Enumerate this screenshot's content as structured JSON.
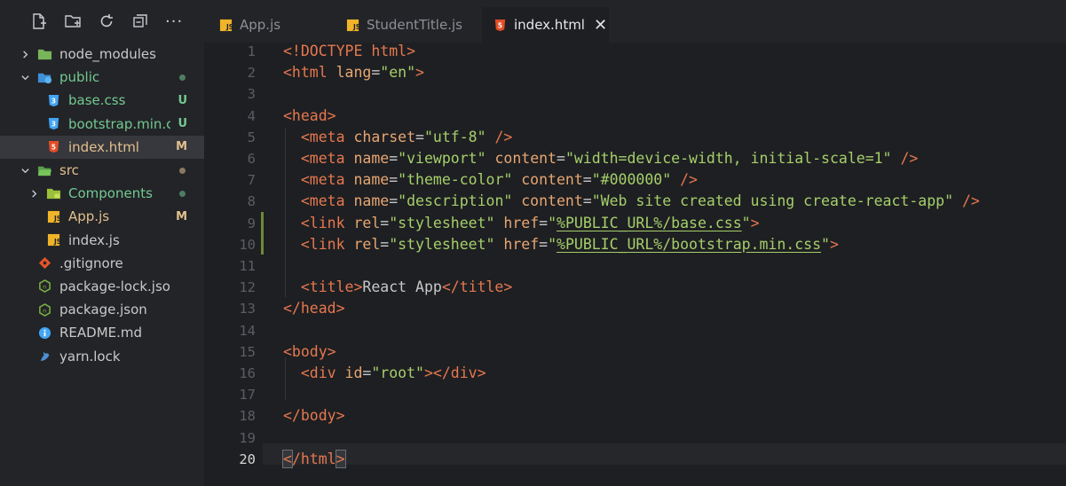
{
  "toolbar": {
    "icons": [
      "new-file-icon",
      "new-folder-icon",
      "refresh-icon",
      "collapse-all-icon",
      "more-icon"
    ],
    "more_label": "···"
  },
  "tabs": [
    {
      "label": "App.js",
      "icon": "js-file-icon",
      "active": false
    },
    {
      "label": "StudentTitle.js",
      "icon": "js-file-icon",
      "active": false
    },
    {
      "label": "index.html",
      "icon": "html-file-icon",
      "active": true,
      "close": "✕"
    }
  ],
  "tree": [
    {
      "label": "node_modules",
      "type": "folder",
      "expanded": false,
      "depth": 0,
      "status": "",
      "dot": false,
      "color": "#c9c9c9"
    },
    {
      "label": "public",
      "type": "folder",
      "expanded": true,
      "depth": 0,
      "status": "",
      "dot": true,
      "color": "#73c991"
    },
    {
      "label": "base.css",
      "type": "css",
      "depth": 1,
      "status": "U",
      "color": "#73c991"
    },
    {
      "label": "bootstrap.min.c...",
      "type": "css",
      "depth": 1,
      "status": "U",
      "color": "#73c991"
    },
    {
      "label": "index.html",
      "type": "html",
      "depth": 1,
      "status": "M",
      "color": "#e2c08d",
      "selected": true
    },
    {
      "label": "src",
      "type": "folder",
      "expanded": true,
      "depth": 0,
      "status": "",
      "dot": true,
      "color": "#e2c08d"
    },
    {
      "label": "Components",
      "type": "folder",
      "expanded": false,
      "depth": 1,
      "status": "",
      "dot": true,
      "color": "#73c991"
    },
    {
      "label": "App.js",
      "type": "js",
      "depth": 1,
      "status": "M",
      "color": "#e2c08d"
    },
    {
      "label": "index.js",
      "type": "js",
      "depth": 1,
      "status": "",
      "color": "#c9c9c9"
    },
    {
      "label": ".gitignore",
      "type": "git",
      "depth": 0,
      "status": "",
      "color": "#c9c9c9"
    },
    {
      "label": "package-lock.json",
      "type": "node",
      "depth": 0,
      "status": "",
      "color": "#c9c9c9"
    },
    {
      "label": "package.json",
      "type": "node",
      "depth": 0,
      "status": "",
      "color": "#c9c9c9"
    },
    {
      "label": "README.md",
      "type": "info",
      "depth": 0,
      "status": "",
      "color": "#c9c9c9"
    },
    {
      "label": "yarn.lock",
      "type": "yarn",
      "depth": 0,
      "status": "",
      "color": "#c9c9c9"
    }
  ],
  "editor": {
    "current_line": 20,
    "lines": [
      [
        [
          "tg",
          "<!DOCTYPE html>"
        ]
      ],
      [
        [
          "tg",
          "<html "
        ],
        [
          "at",
          "lang"
        ],
        [
          "pn",
          "="
        ],
        [
          "st",
          "\"en\""
        ],
        [
          "tg",
          ">"
        ]
      ],
      [],
      [
        [
          "tg",
          "<head>"
        ]
      ],
      [
        [
          "pn",
          "  "
        ],
        [
          "tg",
          "<meta "
        ],
        [
          "at",
          "charset"
        ],
        [
          "pn",
          "="
        ],
        [
          "st",
          "\"utf-8\""
        ],
        [
          "pn",
          " "
        ],
        [
          "tg",
          "/>"
        ]
      ],
      [
        [
          "pn",
          "  "
        ],
        [
          "tg",
          "<meta "
        ],
        [
          "at",
          "name"
        ],
        [
          "pn",
          "="
        ],
        [
          "st",
          "\"viewport\""
        ],
        [
          "pn",
          " "
        ],
        [
          "at",
          "content"
        ],
        [
          "pn",
          "="
        ],
        [
          "st",
          "\"width=device-width, initial-scale=1\""
        ],
        [
          "pn",
          " "
        ],
        [
          "tg",
          "/>"
        ]
      ],
      [
        [
          "pn",
          "  "
        ],
        [
          "tg",
          "<meta "
        ],
        [
          "at",
          "name"
        ],
        [
          "pn",
          "="
        ],
        [
          "st",
          "\"theme-color\""
        ],
        [
          "pn",
          " "
        ],
        [
          "at",
          "content"
        ],
        [
          "pn",
          "="
        ],
        [
          "st",
          "\"#000000\""
        ],
        [
          "pn",
          " "
        ],
        [
          "tg",
          "/>"
        ]
      ],
      [
        [
          "pn",
          "  "
        ],
        [
          "tg",
          "<meta "
        ],
        [
          "at",
          "name"
        ],
        [
          "pn",
          "="
        ],
        [
          "st",
          "\"description\""
        ],
        [
          "pn",
          " "
        ],
        [
          "at",
          "content"
        ],
        [
          "pn",
          "="
        ],
        [
          "st",
          "\"Web site created using create-react-app\""
        ],
        [
          "pn",
          " "
        ],
        [
          "tg",
          "/>"
        ]
      ],
      [
        [
          "pn",
          "  "
        ],
        [
          "tg",
          "<link "
        ],
        [
          "at",
          "rel"
        ],
        [
          "pn",
          "="
        ],
        [
          "st",
          "\"stylesheet\""
        ],
        [
          "pn",
          " "
        ],
        [
          "at",
          "href"
        ],
        [
          "pn",
          "="
        ],
        [
          "st",
          "\""
        ],
        [
          "st u",
          "%PUBLIC_URL%/base.css"
        ],
        [
          "st",
          "\""
        ],
        [
          "tg",
          ">"
        ]
      ],
      [
        [
          "pn",
          "  "
        ],
        [
          "tg",
          "<link "
        ],
        [
          "at",
          "rel"
        ],
        [
          "pn",
          "="
        ],
        [
          "st",
          "\"stylesheet\""
        ],
        [
          "pn",
          " "
        ],
        [
          "at",
          "href"
        ],
        [
          "pn",
          "="
        ],
        [
          "st",
          "\""
        ],
        [
          "st u",
          "%PUBLIC_URL%/bootstrap.min.css"
        ],
        [
          "st",
          "\""
        ],
        [
          "tg",
          ">"
        ]
      ],
      [],
      [
        [
          "pn",
          "  "
        ],
        [
          "tg",
          "<title>"
        ],
        [
          "tx",
          "React App"
        ],
        [
          "tg",
          "</title>"
        ]
      ],
      [
        [
          "tg",
          "</head>"
        ]
      ],
      [],
      [
        [
          "tg",
          "<body>"
        ]
      ],
      [
        [
          "pn",
          "  "
        ],
        [
          "tg",
          "<div "
        ],
        [
          "at",
          "id"
        ],
        [
          "pn",
          "="
        ],
        [
          "st",
          "\"root\""
        ],
        [
          "tg",
          "></div>"
        ]
      ],
      [],
      [
        [
          "tg",
          "</body>"
        ]
      ],
      [],
      [
        [
          "tg bh",
          "<"
        ],
        [
          "tg",
          "/html"
        ],
        [
          "tg bh",
          ">"
        ]
      ]
    ]
  }
}
